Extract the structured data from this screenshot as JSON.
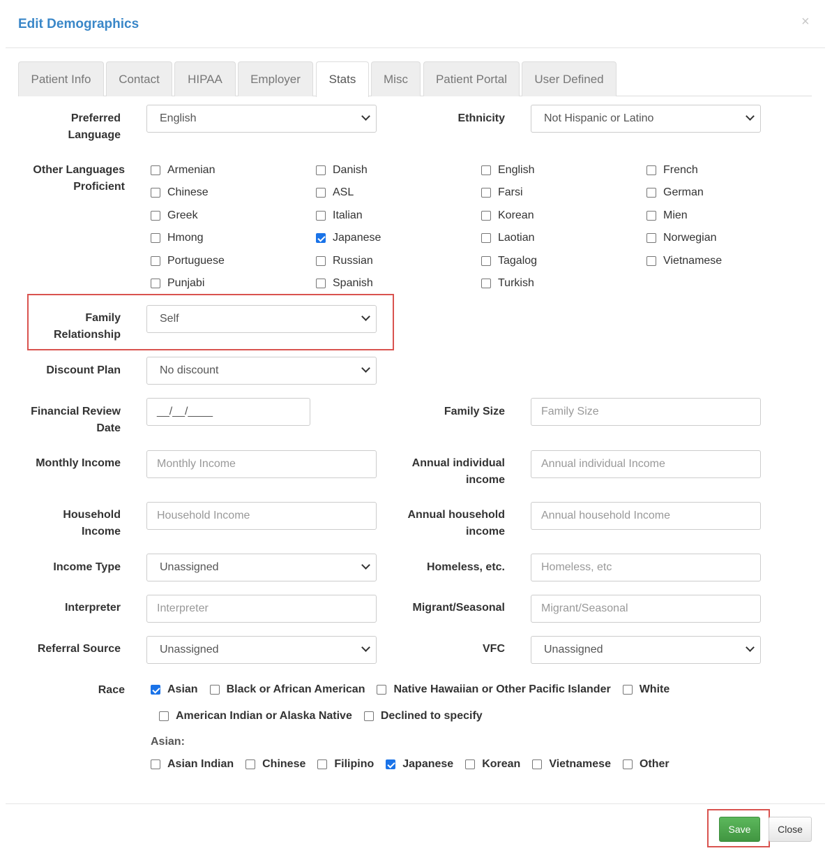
{
  "dialog": {
    "title": "Edit Demographics",
    "close_icon": "×"
  },
  "tabs": [
    {
      "label": "Patient Info"
    },
    {
      "label": "Contact"
    },
    {
      "label": "HIPAA"
    },
    {
      "label": "Employer"
    },
    {
      "label": "Stats",
      "active": true
    },
    {
      "label": "Misc"
    },
    {
      "label": "Patient Portal"
    },
    {
      "label": "User Defined"
    }
  ],
  "fields": {
    "preferred_language": {
      "label": "Preferred\nLanguage",
      "value": "English"
    },
    "ethnicity": {
      "label": "Ethnicity",
      "value": "Not Hispanic or Latino"
    },
    "other_languages_label": "Other Languages\nProficient",
    "family_relationship": {
      "label": "Family\nRelationship",
      "value": "Self"
    },
    "discount_plan": {
      "label": "Discount Plan",
      "value": "No discount"
    },
    "financial_review_date": {
      "label": "Financial Review\nDate",
      "value": "__/__/____"
    },
    "family_size": {
      "label": "Family Size",
      "placeholder": "Family Size"
    },
    "monthly_income": {
      "label": "Monthly Income",
      "placeholder": "Monthly Income"
    },
    "annual_individual_income": {
      "label": "Annual individual\nincome",
      "placeholder": "Annual individual Income"
    },
    "household_income": {
      "label": "Household\nIncome",
      "placeholder": "Household Income"
    },
    "annual_household_income": {
      "label": "Annual household\nincome",
      "placeholder": "Annual household Income"
    },
    "income_type": {
      "label": "Income Type",
      "value": "Unassigned"
    },
    "homeless": {
      "label": "Homeless, etc.",
      "placeholder": "Homeless, etc"
    },
    "interpreter": {
      "label": "Interpreter",
      "placeholder": "Interpreter"
    },
    "migrant": {
      "label": "Migrant/Seasonal",
      "placeholder": "Migrant/Seasonal"
    },
    "referral_source": {
      "label": "Referral Source",
      "value": "Unassigned"
    },
    "vfc": {
      "label": "VFC",
      "value": "Unassigned"
    }
  },
  "languages": [
    [
      {
        "label": "Armenian"
      },
      {
        "label": "Chinese"
      },
      {
        "label": "Greek"
      },
      {
        "label": "Hmong"
      },
      {
        "label": "Portuguese"
      },
      {
        "label": "Punjabi"
      }
    ],
    [
      {
        "label": "Danish"
      },
      {
        "label": "ASL"
      },
      {
        "label": "Italian"
      },
      {
        "label": "Japanese",
        "checked": true
      },
      {
        "label": "Russian"
      },
      {
        "label": "Spanish"
      }
    ],
    [
      {
        "label": "English"
      },
      {
        "label": "Farsi"
      },
      {
        "label": "Korean"
      },
      {
        "label": "Laotian"
      },
      {
        "label": "Tagalog"
      },
      {
        "label": "Turkish"
      }
    ],
    [
      {
        "label": "French"
      },
      {
        "label": "German"
      },
      {
        "label": "Mien"
      },
      {
        "label": "Norwegian"
      },
      {
        "label": "Vietnamese"
      }
    ]
  ],
  "race": {
    "label": "Race",
    "row1": [
      {
        "label": "Asian",
        "checked": true
      },
      {
        "label": "Black or African American"
      },
      {
        "label": "Native Hawaiian or Other Pacific Islander"
      },
      {
        "label": "White"
      }
    ],
    "row2": [
      {
        "label": "American Indian or Alaska Native"
      },
      {
        "label": "Declined to specify"
      }
    ],
    "asian_label": "Asian:",
    "asian": [
      {
        "label": "Asian Indian"
      },
      {
        "label": "Chinese"
      },
      {
        "label": "Filipino"
      },
      {
        "label": "Japanese",
        "checked": true
      },
      {
        "label": "Korean"
      },
      {
        "label": "Vietnamese"
      },
      {
        "label": "Other"
      }
    ]
  },
  "footer": {
    "save": "Save",
    "close": "Close"
  },
  "colors": {
    "accent": "#3a87c8",
    "save": "#4cae4c",
    "highlight": "#d9534f"
  }
}
